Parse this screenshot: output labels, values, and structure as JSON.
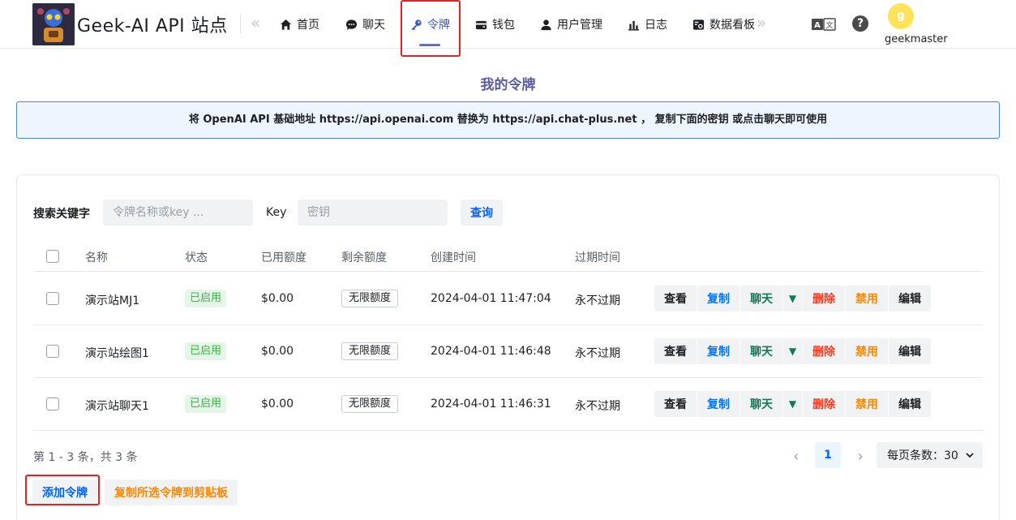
{
  "header": {
    "site_title": "Geek-AI API 站点",
    "nav": [
      {
        "label": "首页",
        "icon": "home-icon"
      },
      {
        "label": "聊天",
        "icon": "chat-bubble-icon"
      },
      {
        "label": "令牌",
        "icon": "key-icon",
        "active": true
      },
      {
        "label": "钱包",
        "icon": "wallet-icon"
      },
      {
        "label": "用户管理",
        "icon": "user-icon"
      },
      {
        "label": "日志",
        "icon": "bar-chart-icon"
      },
      {
        "label": "数据看板",
        "icon": "dashboard-icon"
      }
    ],
    "avatar_letter": "g",
    "username": "geekmaster"
  },
  "page": {
    "title": "我的令牌",
    "banner": "将 OpenAI API 基础地址 https://api.openai.com 替换为 https://api.chat-plus.net ， 复制下面的密钥 或点击聊天即可使用"
  },
  "search": {
    "label": "搜索关键字",
    "keyword_placeholder": "令牌名称或key ...",
    "key_label": "Key",
    "key_placeholder": "密钥",
    "query_label": "查询"
  },
  "table": {
    "columns": [
      "名称",
      "状态",
      "已用额度",
      "剩余额度",
      "创建时间",
      "过期时间"
    ],
    "rows": [
      {
        "name": "演示站MJ1",
        "status": "已启用",
        "used": "$0.00",
        "remain": "无限额度",
        "created": "2024-04-01 11:47:04",
        "expire": "永不过期"
      },
      {
        "name": "演示站绘图1",
        "status": "已启用",
        "used": "$0.00",
        "remain": "无限额度",
        "created": "2024-04-01 11:46:48",
        "expire": "永不过期"
      },
      {
        "name": "演示站聊天1",
        "status": "已启用",
        "used": "$0.00",
        "remain": "无限额度",
        "created": "2024-04-01 11:46:31",
        "expire": "永不过期"
      }
    ],
    "actions": {
      "view": "查看",
      "copy": "复制",
      "chat": "聊天",
      "delete": "删除",
      "disable": "禁用",
      "edit": "编辑"
    }
  },
  "pagination": {
    "info": "第 1 - 3 条，共 3 条",
    "current_page": "1",
    "page_size": "每页条数：30"
  },
  "footer_buttons": {
    "add": "添加令牌",
    "copy_selected": "复制所选令牌到剪贴板"
  },
  "colors": {
    "highlight": "#e02323",
    "primary": "#0064fa",
    "active_nav": "#3a56c4",
    "success": "#3bb346",
    "warning": "#fc8800",
    "danger": "#f93920"
  }
}
